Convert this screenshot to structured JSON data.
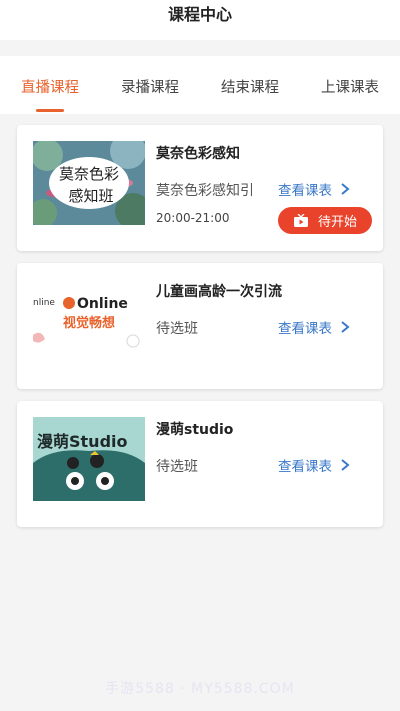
{
  "header": {
    "title": "课程中心"
  },
  "tabs": [
    {
      "label": "直播课程",
      "active": true
    },
    {
      "label": "录播课程",
      "active": false
    },
    {
      "label": "结束课程",
      "active": false
    },
    {
      "label": "上课课表",
      "active": false
    }
  ],
  "courses": [
    {
      "title": "莫奈色彩感知",
      "subtitle": "莫奈色彩感知引",
      "time": "20:00-21:00",
      "thumb_text": [
        "莫奈色彩",
        "感知班"
      ],
      "link_label": "查看课表",
      "status_label": "待开始"
    },
    {
      "title": "儿童画高龄一次引流",
      "subtitle": "待选班",
      "thumb_text": [
        "Online",
        "视觉畅想"
      ],
      "link_label": "查看课表"
    },
    {
      "title": "漫萌studio",
      "subtitle": "待选班",
      "thumb_text": [
        "漫萌Studio"
      ],
      "link_label": "查看课表"
    }
  ],
  "watermark": "手游5588 · MY5588.COM",
  "colors": {
    "accent": "#e8622c",
    "link": "#3a78c9",
    "status_button": "#e9432c"
  }
}
